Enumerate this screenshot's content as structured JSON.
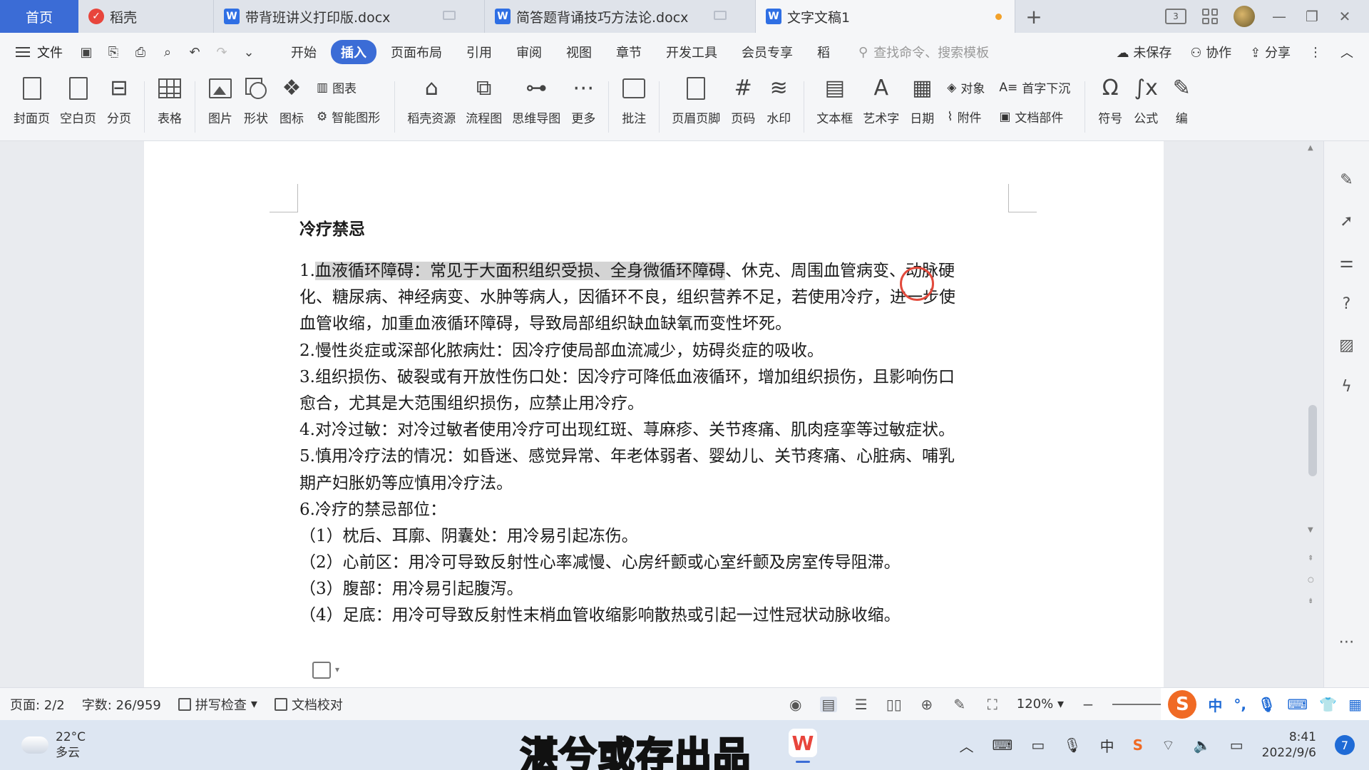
{
  "tabs": {
    "home": "首页",
    "docer": "稻壳",
    "doc1": "带背班讲义打印版.docx",
    "doc2": "简答题背诵技巧方法论.docx",
    "active": "文字文稿1",
    "new_tab": "+"
  },
  "titlebar_right": {
    "layout_badge": "3"
  },
  "menu": {
    "file": "文件",
    "items": [
      "开始",
      "插入",
      "页面布局",
      "引用",
      "审阅",
      "视图",
      "章节",
      "开发工具",
      "会员专享",
      "稻"
    ],
    "active_index": 1,
    "search_placeholder": "查找命令、搜索模板",
    "unsaved": "未保存",
    "collab": "协作",
    "share": "分享"
  },
  "ribbon": {
    "cover": "封面页",
    "blank": "空白页",
    "pagebreak": "分页",
    "table": "表格",
    "picture": "图片",
    "shape": "形状",
    "icon": "图标",
    "chart": "图表",
    "smartart": "智能图形",
    "docer_res": "稻壳资源",
    "flowchart": "流程图",
    "mindmap": "思维导图",
    "more": "更多",
    "comment": "批注",
    "header_footer": "页眉页脚",
    "page_num": "页码",
    "watermark": "水印",
    "textbox": "文本框",
    "wordart": "艺术字",
    "date": "日期",
    "object": "对象",
    "attachment": "附件",
    "dropcap": "首字下沉",
    "docpart": "文档部件",
    "symbol": "符号",
    "formula": "公式",
    "edit": "编"
  },
  "document": {
    "title": "冷疗禁忌",
    "line1_num": "1.",
    "line1_highlight": "血液循环障碍：常见于大面积组织受损、全身微循环障碍",
    "line1_rest": "、休克、周围血管病变、动脉硬",
    "lines": [
      "化、糖尿病、神经病变、水肿等病人，因循环不良，组织营养不足，若使用冷疗，进一步使",
      "血管收缩，加重血液循环障碍，导致局部组织缺血缺氧而变性坏死。",
      "2.慢性炎症或深部化脓病灶：因冷疗使局部血流减少，妨碍炎症的吸收。",
      "3.组织损伤、破裂或有开放性伤口处：因冷疗可降低血液循环，增加组织损伤，且影响伤口",
      "愈合，尤其是大范围组织损伤，应禁止用冷疗。",
      "4.对冷过敏：对冷过敏者使用冷疗可出现红斑、荨麻疹、关节疼痛、肌肉痉挛等过敏症状。",
      "5.慎用冷疗法的情况：如昏迷、感觉异常、年老体弱者、婴幼儿、关节疼痛、心脏病、哺乳",
      "期产妇胀奶等应慎用冷疗法。",
      "6.冷疗的禁忌部位：",
      "（1）枕后、耳廓、阴囊处：用冷易引起冻伤。",
      "（2）心前区：用冷可导致反射性心率减慢、心房纤颤或心室纤颤及房室传导阻滞。",
      "（3）腹部：用冷易引起腹泻。",
      "（4）足底：用冷可导致反射性末梢血管收缩影响散热或引起一过性冠状动脉收缩。"
    ]
  },
  "status": {
    "page": "页面: 2/2",
    "wordcount": "字数: 26/959",
    "spellcheck": "拼写检查",
    "proofread": "文档校对",
    "zoom": "120%",
    "ime_cn": "中"
  },
  "taskbar": {
    "temp": "22°C",
    "weather": "多云",
    "caption": "湛兮或存出品",
    "tray_cn": "中",
    "time": "8:41",
    "date": "2022/9/6",
    "notifications": "7"
  },
  "colors": {
    "accent": "#3b6cd6",
    "highlight": "#d4d4d4",
    "cursor_ring": "#e24a3c"
  }
}
